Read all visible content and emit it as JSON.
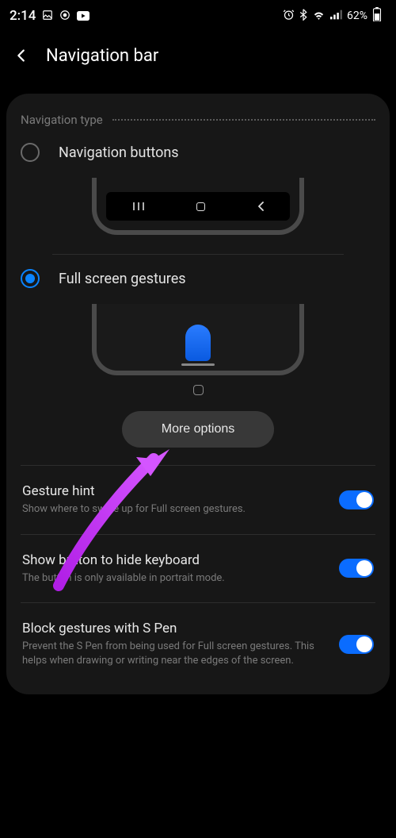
{
  "status": {
    "time": "2:14",
    "battery": "62%",
    "icons": [
      "image-icon",
      "circle-icon",
      "youtube-icon",
      "alarm-icon",
      "bluetooth-icon",
      "wifi-icon",
      "signal-icon",
      "battery-icon"
    ]
  },
  "header": {
    "title": "Navigation bar"
  },
  "panel": {
    "section_label": "Navigation type",
    "options": [
      {
        "label": "Navigation buttons",
        "selected": false
      },
      {
        "label": "Full screen gestures",
        "selected": true
      }
    ],
    "more_options_label": "More options",
    "settings": [
      {
        "title": "Gesture hint",
        "desc": "Show where to swipe up for Full screen gestures.",
        "on": true
      },
      {
        "title": "Show button to hide keyboard",
        "desc": "The button is only available in portrait mode.",
        "on": true
      },
      {
        "title": "Block gestures with S Pen",
        "desc": "Prevent the S Pen from being used for Full screen gestures. This helps when drawing or writing near the edges of the screen.",
        "on": true
      }
    ]
  },
  "colors": {
    "accent": "#0a84ff",
    "toggle": "#0a6cff",
    "arrow": "#b01ee6"
  }
}
